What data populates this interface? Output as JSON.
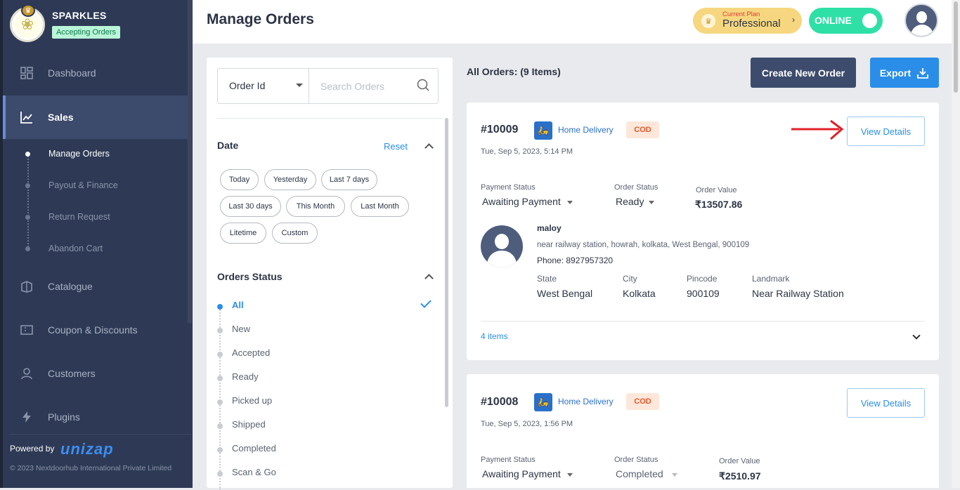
{
  "store": {
    "name": "SPARKLES",
    "status_badge": "Accepting Orders"
  },
  "sidebar": {
    "items": [
      {
        "label": "Dashboard",
        "icon": "dashboard-icon"
      },
      {
        "label": "Sales",
        "icon": "chart-icon",
        "active": true
      },
      {
        "label": "Catalogue",
        "icon": "catalogue-icon"
      },
      {
        "label": "Coupon & Discounts",
        "icon": "coupon-icon"
      },
      {
        "label": "Customers",
        "icon": "user-icon"
      },
      {
        "label": "Plugins",
        "icon": "bolt-icon"
      }
    ],
    "sales_sub": [
      "Manage Orders",
      "Payout & Finance",
      "Return Request",
      "Abandon Cart"
    ],
    "powered_by": "Powered by",
    "powered_brand": "unizap",
    "copyright": "© 2023 Nextdoorhub International Private Limited"
  },
  "header": {
    "title": "Manage Orders",
    "plan_label": "Current Plan",
    "plan_name": "Professional",
    "online_label": "ONLINE"
  },
  "filters": {
    "search_type": "Order Id",
    "search_placeholder": "Search Orders",
    "date_title": "Date",
    "reset_label": "Reset",
    "date_chips": [
      "Today",
      "Yesterday",
      "Last 7 days",
      "Last 30 days",
      "This Month",
      "Last Month",
      "Litetime",
      "Custom"
    ],
    "status_title": "Orders Status",
    "statuses": [
      "All",
      "New",
      "Accepted",
      "Ready",
      "Picked up",
      "Shipped",
      "Completed",
      "Scan & Go"
    ],
    "selected_status": "All"
  },
  "orders_header": {
    "summary": "All Orders: (9 Items)",
    "create_label": "Create New Order",
    "export_label": "Export"
  },
  "labels": {
    "payment_status": "Payment Status",
    "order_status": "Order Status",
    "order_value": "Order Value",
    "state": "State",
    "city": "City",
    "pincode": "Pincode",
    "landmark": "Landmark",
    "view_details": "View Details"
  },
  "orders": [
    {
      "id": "#10009",
      "delivery": "Home Delivery",
      "payment_type": "COD",
      "date": "Tue, Sep 5, 2023, 5:14 PM",
      "payment_status": "Awaiting Payment",
      "order_status": "Ready",
      "order_value": "₹13507.86",
      "customer_name": "maloy",
      "address": "near railway station, howrah, kolkata, West Bengal, 900109",
      "phone": "Phone: 8927957320",
      "state": "West Bengal",
      "city": "Kolkata",
      "pincode": "900109",
      "landmark": "Near Railway Station",
      "items": "4 items"
    },
    {
      "id": "#10008",
      "delivery": "Home Delivery",
      "payment_type": "COD",
      "date": "Tue, Sep 5, 2023, 1:56 PM",
      "payment_status": "Awaiting Payment",
      "order_status": "Completed",
      "order_value": "₹2510.97"
    }
  ],
  "colors": {
    "sidebar": "#2e3a55",
    "accent": "#2a8ee8",
    "online": "#2ee0a6",
    "plan": "#f6d77f",
    "cod": "#e2592a"
  }
}
